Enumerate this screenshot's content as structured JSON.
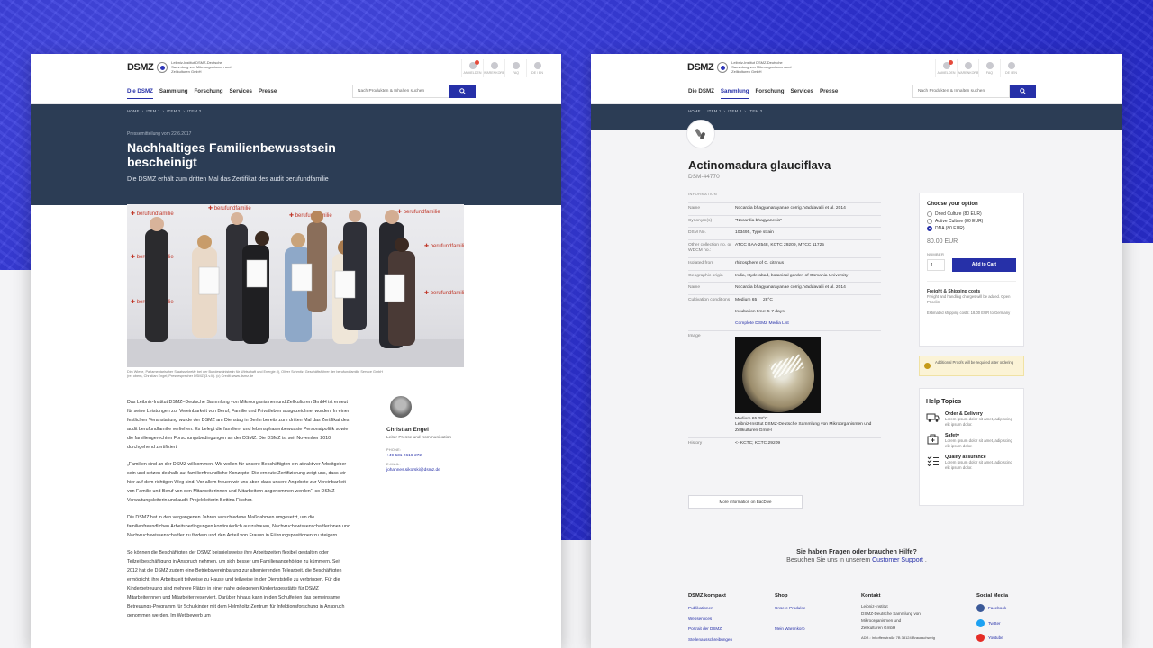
{
  "left_page": {
    "header": {
      "logo": "DSMZ",
      "logo_sub": "Leibniz-Institut DSMZ-Deutsche Sammlung von Mikroorganismen und Zellkulturen GmbH",
      "icons": [
        {
          "name": "user-icon",
          "label": "ANMELDEN"
        },
        {
          "name": "cart-icon",
          "label": "WARENKORB"
        },
        {
          "name": "faq-icon",
          "label": "FAQ"
        },
        {
          "name": "language-icon",
          "label": "DE / EN"
        }
      ],
      "nav": [
        "Die DSMZ",
        "Sammlung",
        "Forschung",
        "Services",
        "Presse"
      ],
      "search_placeholder": "Nach Produkten & Inhalten suchen"
    },
    "breadcrumb": [
      "HOME",
      "ITEM 1",
      "ITEM 2",
      "ITEM 3"
    ],
    "press_date": "Pressemitteilung vom 22.6.2017",
    "title": "Nachhaltiges Familienbewusstsein bescheinigt",
    "lead": "Die DSMZ erhält zum dritten Mal das Zertifikat des audit berufundfamilie",
    "caption": "Dirk Wiese, Parlamentarischer Staatssekretär bei der Bundesministerin für Wirtschaft und Energie (l), Oliver Schmitz, Geschäftsführer der berufundfamilie Service GmbH (re. oben), Christian Engel, Pressesprecher DSMZ (3.v.li.). (c) Credit: www.dsmz.de",
    "paragraphs": [
      "Das Leibniz-Institut DSMZ–Deutsche Sammlung von Mikroorganismen und Zellkulturen GmbH ist erneut für seine Leistungen zur Vereinbarkeit von Beruf, Familie und Privatleben ausgezeichnet worden. In einer festlichen Veranstaltung wurde der DSMZ am Dienstag in Berlin bereits zum dritten Mal das Zertifikat des audit berufundfamilie verliehen. Es belegt die familien- und lebensphasenbewusste Personalpolitik sowie die familiengerechten Forschungsbedingungen an der DSMZ. Die DSMZ ist seit November 2010 durchgehend zertifiziert.",
      "„Familien sind an der DSMZ willkommen. Wir wollen für unsere Beschäftigten ein attraktiver Arbeitgeber sein und setzen deshalb auf familienfreundliche Konzepte. Die erneute Zertifizierung zeigt uns, dass wir hier auf dem richtigen Weg sind. Vor allem freuen wir uns aber, dass unsere Angebote zur Vereinbarkeit von Familie und Beruf von den Mitarbeiterinnen und Mitarbeitern angenommen werden“, so DSMZ-Verwaltungsleiterin und audit-Projektleiterin Bettina Fischer.",
      "Die DSMZ hat in den vergangenen Jahren verschiedene Maßnahmen umgesetzt, um die familienfreundlichen Arbeitsbedingungen kontinuierlich auszubauen, Nachwuchswissenschaftlerinnen und Nachwuchswissenschaftler zu fördern und den Anteil von Frauen in Führungspositionen zu steigern.",
      "So können die Beschäftigten der DSMZ beispielsweise ihre Arbeitszeiten flexibel gestalten oder Teilzeitbeschäftigung in Anspruch nehmen, um sich besser um Familienangehörige zu kümmern. Seit 2012 hat die DSMZ zudem eine Betriebsvereinbarung zur alternierenden Telearbeit, die Beschäftigten ermöglicht, ihre Arbeitszeit teilweise zu Hause und teilweise in der Dienststelle zu verbringen. Für die Kinderbetreuung sind mehrere Plätze in einer nahe gelegenen Kindertagesstätte für DSMZ Mitarbeiterinnen und Mitarbeiter reserviert. Darüber hinaus kann in den Schulferien das gemeinsame Betreuungs-Programm für Schulkinder mit dem Helmholtz-Zentrum für Infektionsforschung in Anspruch genommen werden. Im Wettbewerb um"
    ],
    "contact": {
      "name": "Christian Engel",
      "role": "Leiter Presse und Kommunikation",
      "phone_label": "PHONE:",
      "phone": "+49 531 2616-272",
      "email_label": "E-MAIL:",
      "email": "johannes.sikorski@dsmz.de"
    },
    "photo_banner": "berufundfamilie"
  },
  "right_page": {
    "header": {
      "logo": "DSMZ",
      "logo_sub": "Leibniz-Institut DSMZ-Deutsche Sammlung von Mikroorganismen und Zellkulturen GmbH",
      "icons": [
        {
          "name": "user-icon",
          "label": "ANMELDEN"
        },
        {
          "name": "cart-icon",
          "label": "WARENKORB"
        },
        {
          "name": "faq-icon",
          "label": "FAQ"
        },
        {
          "name": "language-icon",
          "label": "DE / EN"
        }
      ],
      "nav": [
        "Die DSMZ",
        "Sammlung",
        "Forschung",
        "Services",
        "Presse"
      ],
      "search_placeholder": "Nach Produkten & Inhalten suchen"
    },
    "breadcrumb": [
      "HOME",
      "ITEM 1",
      "ITEM 2",
      "ITEM 3"
    ],
    "title": "Actinomadura glauciflava",
    "dsm_number": "DSM-44770",
    "info_label": "INFORMATION",
    "rows": [
      {
        "k": "Name",
        "v": "Nocardia bhagyanarayanae corrig. Vaddavalli et al. 2014"
      },
      {
        "k": "Synonym(s)",
        "v": "\"Nocardia bhagyanesis\""
      },
      {
        "k": "DSM No.",
        "v": "103495, Type strain"
      },
      {
        "k": "Other collection no. or WDCM no.:",
        "v": "ATCC BAA-2548, KCTC 29209, MTCC 11725"
      },
      {
        "k": "Isolated from",
        "v": "rhizosphere of C. citrinus"
      },
      {
        "k": "Geographic origin",
        "v": "India, Hyderabad, botanical garden of Osmania University"
      },
      {
        "k": "Name",
        "v": "Nocardia bhagyanarayanae corrig. Vaddavalli et al. 2014"
      }
    ],
    "cultivation": {
      "k": "Cultivation conditions",
      "medium": "Medium 65     28°C",
      "incubation": "Incubation time: 5-7 days",
      "link": "Complete DSMZ Media List"
    },
    "image_row": {
      "k": "Image",
      "caption_line1": "Medium 65 28°C",
      "caption_line2": "Leibniz-Institut DSMZ-Deutsche Sammlung von Mikroorganismen und Zellkulturen GmbH"
    },
    "history": {
      "k": "History",
      "v": "<- KCTC; KCTC 29209"
    },
    "more_button": "More information on BacDive",
    "purchase": {
      "title": "Choose your option",
      "options": [
        {
          "label": "Dried Culture (80 EUR)",
          "selected": false
        },
        {
          "label": "Active Culture (80 EUR)",
          "selected": false
        },
        {
          "label": "DNA (80 EUR)",
          "selected": true
        }
      ],
      "price": "80.00 EUR",
      "number_label": "NUMBER",
      "qty": "1",
      "add_to_cart": "Add to Cart",
      "ship_title": "Freight & Shipping costs",
      "ship_text": "Freight and handling charges will be added. Open Pricelist",
      "est_text": "Estimated shipping costs: 18.00 EUR to Germany",
      "alert": "Additional Proofs will be required after ordering"
    },
    "help": {
      "title": "Help Topics",
      "items": [
        {
          "t": "Order & Delivery",
          "d": "Lorem ipsum dolor sit amet, adipiscing elit ipsum dolor."
        },
        {
          "t": "Safety",
          "d": "Lorem ipsum dolor sit amet, adipiscing elit ipsum dolor."
        },
        {
          "t": "Quality assurance",
          "d": "Lorem ipsum dolor sit amet, adipiscing elit ipsum dolor."
        }
      ]
    },
    "faq": {
      "q": "Sie haben Fragen oder brauchen Hilfe?",
      "a_pre": "Besuchen Sie uns in unserem",
      "a_link": "Customer Support",
      "a_post": "."
    },
    "footer": {
      "col1": {
        "h": "DSMZ kompakt",
        "links": [
          "Publikationen",
          "Webservices",
          "Portrait der DSMZ",
          "Stellenausschreibungen"
        ]
      },
      "col2": {
        "h": "Shop",
        "links": [
          "Unsere Produkte",
          "Mein Warenkorb"
        ]
      },
      "col3": {
        "h": "Kontakt",
        "lines": [
          "Leibniz-Institut",
          "DSMZ-Deutsche Sammlung von",
          "Mikroorganismen und",
          "Zellkulturen GmbH"
        ],
        "addr_label": "ADR.:",
        "addr": "Inhoffenstraße 7B 38124 Braunschweig"
      },
      "col4": {
        "h": "Social Media",
        "links": [
          "Facebook",
          "Twitter",
          "Youtube"
        ]
      }
    }
  },
  "colors": {
    "accent": "#2630a8",
    "hero": "#2c3d55",
    "background_blue": "#2f33d6"
  }
}
